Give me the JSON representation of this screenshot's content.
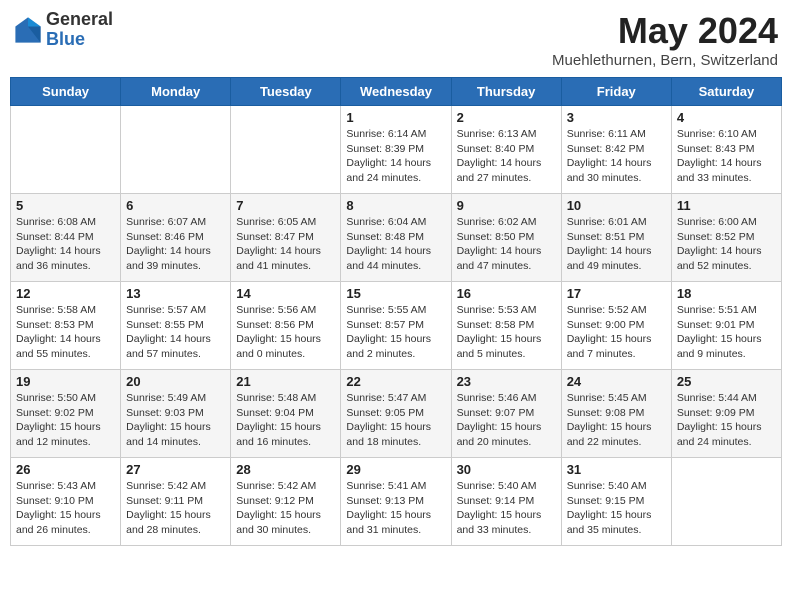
{
  "header": {
    "logo_general": "General",
    "logo_blue": "Blue",
    "month_year": "May 2024",
    "location": "Muehlethurnen, Bern, Switzerland"
  },
  "days_of_week": [
    "Sunday",
    "Monday",
    "Tuesday",
    "Wednesday",
    "Thursday",
    "Friday",
    "Saturday"
  ],
  "weeks": [
    [
      {
        "day": "",
        "info": ""
      },
      {
        "day": "",
        "info": ""
      },
      {
        "day": "",
        "info": ""
      },
      {
        "day": "1",
        "info": "Sunrise: 6:14 AM\nSunset: 8:39 PM\nDaylight: 14 hours\nand 24 minutes."
      },
      {
        "day": "2",
        "info": "Sunrise: 6:13 AM\nSunset: 8:40 PM\nDaylight: 14 hours\nand 27 minutes."
      },
      {
        "day": "3",
        "info": "Sunrise: 6:11 AM\nSunset: 8:42 PM\nDaylight: 14 hours\nand 30 minutes."
      },
      {
        "day": "4",
        "info": "Sunrise: 6:10 AM\nSunset: 8:43 PM\nDaylight: 14 hours\nand 33 minutes."
      }
    ],
    [
      {
        "day": "5",
        "info": "Sunrise: 6:08 AM\nSunset: 8:44 PM\nDaylight: 14 hours\nand 36 minutes."
      },
      {
        "day": "6",
        "info": "Sunrise: 6:07 AM\nSunset: 8:46 PM\nDaylight: 14 hours\nand 39 minutes."
      },
      {
        "day": "7",
        "info": "Sunrise: 6:05 AM\nSunset: 8:47 PM\nDaylight: 14 hours\nand 41 minutes."
      },
      {
        "day": "8",
        "info": "Sunrise: 6:04 AM\nSunset: 8:48 PM\nDaylight: 14 hours\nand 44 minutes."
      },
      {
        "day": "9",
        "info": "Sunrise: 6:02 AM\nSunset: 8:50 PM\nDaylight: 14 hours\nand 47 minutes."
      },
      {
        "day": "10",
        "info": "Sunrise: 6:01 AM\nSunset: 8:51 PM\nDaylight: 14 hours\nand 49 minutes."
      },
      {
        "day": "11",
        "info": "Sunrise: 6:00 AM\nSunset: 8:52 PM\nDaylight: 14 hours\nand 52 minutes."
      }
    ],
    [
      {
        "day": "12",
        "info": "Sunrise: 5:58 AM\nSunset: 8:53 PM\nDaylight: 14 hours\nand 55 minutes."
      },
      {
        "day": "13",
        "info": "Sunrise: 5:57 AM\nSunset: 8:55 PM\nDaylight: 14 hours\nand 57 minutes."
      },
      {
        "day": "14",
        "info": "Sunrise: 5:56 AM\nSunset: 8:56 PM\nDaylight: 15 hours\nand 0 minutes."
      },
      {
        "day": "15",
        "info": "Sunrise: 5:55 AM\nSunset: 8:57 PM\nDaylight: 15 hours\nand 2 minutes."
      },
      {
        "day": "16",
        "info": "Sunrise: 5:53 AM\nSunset: 8:58 PM\nDaylight: 15 hours\nand 5 minutes."
      },
      {
        "day": "17",
        "info": "Sunrise: 5:52 AM\nSunset: 9:00 PM\nDaylight: 15 hours\nand 7 minutes."
      },
      {
        "day": "18",
        "info": "Sunrise: 5:51 AM\nSunset: 9:01 PM\nDaylight: 15 hours\nand 9 minutes."
      }
    ],
    [
      {
        "day": "19",
        "info": "Sunrise: 5:50 AM\nSunset: 9:02 PM\nDaylight: 15 hours\nand 12 minutes."
      },
      {
        "day": "20",
        "info": "Sunrise: 5:49 AM\nSunset: 9:03 PM\nDaylight: 15 hours\nand 14 minutes."
      },
      {
        "day": "21",
        "info": "Sunrise: 5:48 AM\nSunset: 9:04 PM\nDaylight: 15 hours\nand 16 minutes."
      },
      {
        "day": "22",
        "info": "Sunrise: 5:47 AM\nSunset: 9:05 PM\nDaylight: 15 hours\nand 18 minutes."
      },
      {
        "day": "23",
        "info": "Sunrise: 5:46 AM\nSunset: 9:07 PM\nDaylight: 15 hours\nand 20 minutes."
      },
      {
        "day": "24",
        "info": "Sunrise: 5:45 AM\nSunset: 9:08 PM\nDaylight: 15 hours\nand 22 minutes."
      },
      {
        "day": "25",
        "info": "Sunrise: 5:44 AM\nSunset: 9:09 PM\nDaylight: 15 hours\nand 24 minutes."
      }
    ],
    [
      {
        "day": "26",
        "info": "Sunrise: 5:43 AM\nSunset: 9:10 PM\nDaylight: 15 hours\nand 26 minutes."
      },
      {
        "day": "27",
        "info": "Sunrise: 5:42 AM\nSunset: 9:11 PM\nDaylight: 15 hours\nand 28 minutes."
      },
      {
        "day": "28",
        "info": "Sunrise: 5:42 AM\nSunset: 9:12 PM\nDaylight: 15 hours\nand 30 minutes."
      },
      {
        "day": "29",
        "info": "Sunrise: 5:41 AM\nSunset: 9:13 PM\nDaylight: 15 hours\nand 31 minutes."
      },
      {
        "day": "30",
        "info": "Sunrise: 5:40 AM\nSunset: 9:14 PM\nDaylight: 15 hours\nand 33 minutes."
      },
      {
        "day": "31",
        "info": "Sunrise: 5:40 AM\nSunset: 9:15 PM\nDaylight: 15 hours\nand 35 minutes."
      },
      {
        "day": "",
        "info": ""
      }
    ]
  ]
}
